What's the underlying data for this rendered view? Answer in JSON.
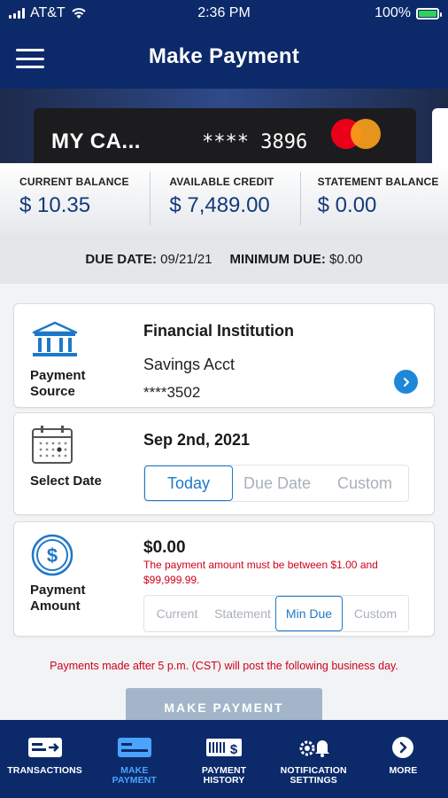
{
  "status_bar": {
    "carrier": "AT&T",
    "time": "2:36 PM",
    "battery": "100%"
  },
  "header": {
    "title": "Make Payment"
  },
  "card": {
    "name": "MY CA...",
    "number": "**** 3896"
  },
  "balances": [
    {
      "label": "CURRENT BALANCE",
      "value": "$ 10.35"
    },
    {
      "label": "AVAILABLE CREDIT",
      "value": "$ 7,489.00"
    },
    {
      "label": "STATEMENT BALANCE",
      "value": "$ 0.00"
    }
  ],
  "due": {
    "due_date_label": "DUE DATE:",
    "due_date": "09/21/21",
    "minimum_due_label": "MINIMUM DUE:",
    "minimum_due": "$0.00"
  },
  "payment_source": {
    "label_line1": "Payment",
    "label_line2": "Source",
    "title": "Financial Institution",
    "account": "Savings Acct",
    "account_number": "****3502"
  },
  "select_date": {
    "label": "Select Date",
    "date": "Sep 2nd, 2021",
    "options": [
      "Today",
      "Due Date",
      "Custom"
    ],
    "selected": "Today"
  },
  "payment_amount": {
    "label_line1": "Payment",
    "label_line2": "Amount",
    "amount": "$0.00",
    "error": "The payment amount must be between $1.00 and $99,999.99.",
    "options": [
      "Current",
      "Statement",
      "Min Due",
      "Custom"
    ],
    "selected": "Min Due"
  },
  "notice": "Payments made after 5 p.m. (CST) will post the following business day.",
  "make_payment_button": "MAKE PAYMENT",
  "bottom_nav": [
    {
      "line1": "TRANSACTIONS",
      "line2": "",
      "icon": "transactions-icon"
    },
    {
      "line1": "MAKE",
      "line2": "PAYMENT",
      "icon": "make-payment-icon"
    },
    {
      "line1": "PAYMENT",
      "line2": "HISTORY",
      "icon": "payment-history-icon"
    },
    {
      "line1": "NOTIFICATION",
      "line2": "SETTINGS",
      "icon": "notification-settings-icon"
    },
    {
      "line1": "MORE",
      "line2": "",
      "icon": "more-icon"
    }
  ],
  "colors": {
    "navy": "#0c2a6a",
    "accent": "#1e78c8",
    "error": "#d0021b",
    "active_nav": "#4aa3ff"
  }
}
